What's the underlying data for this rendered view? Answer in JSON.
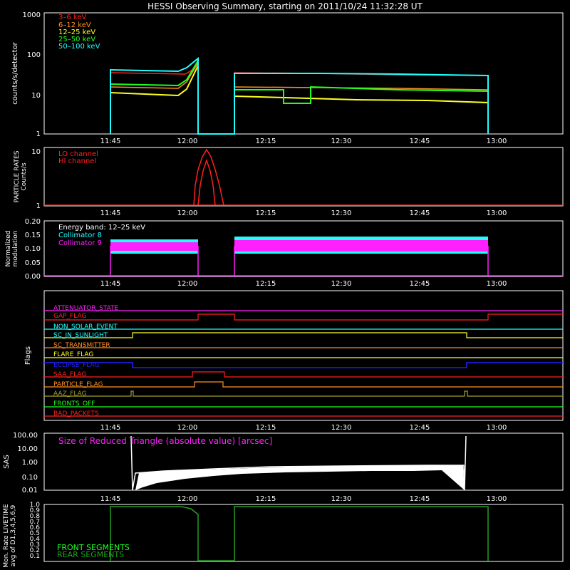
{
  "title": "HESSI Observing Summary, starting on 2011/10/24 11:32:28 UT",
  "x_tick_labels": [
    "11:45",
    "12:00",
    "12:15",
    "12:30",
    "12:45",
    "13:00"
  ],
  "colors": {
    "background": "#000000",
    "axes": "#ffffff",
    "red": "#ff2020",
    "orange": "#ff9020",
    "yellow": "#ffff20",
    "green": "#20ff20",
    "cyan": "#20ffff",
    "magenta": "#ff20ff",
    "blue": "#2020ff",
    "olive": "#a0a030",
    "darkgreen": "#20a020"
  },
  "panels": {
    "lightcurves": {
      "ylabel": "counts/s/detector",
      "y_ticks": [
        "1",
        "10",
        "100",
        "1000"
      ],
      "legend": [
        "3–6 keV",
        "6–12 keV",
        "12–25 keV",
        "25–50 keV",
        "50–100 keV"
      ]
    },
    "particle": {
      "ylabel_line1": "PARTICLE RATES",
      "ylabel_line2": "Counts/s",
      "y_ticks": [
        "1",
        "10"
      ],
      "legend": [
        "LO channel",
        "HI channel"
      ]
    },
    "modulation": {
      "ylabel_line1": "Normalized",
      "ylabel_line2": "modulation",
      "y_ticks": [
        "0.00",
        "0.05",
        "0.10",
        "0.15",
        "0.20"
      ],
      "legend": [
        "Energy band: 12–25 keV",
        "Collimator 8",
        "Collimator 9"
      ]
    },
    "flags": {
      "ylabel": "Flags",
      "names": [
        "ATTENUATOR_STATE",
        "GAP_FLAG",
        "NON_SOLAR_EVENT",
        "SC_IN_SUNLIGHT",
        "SC_TRANSMITTER",
        "FLARE_FLAG",
        "ECLIPSE_FLAG",
        "SAA_FLAG",
        "PARTICLE_FLAG",
        "AAZ_FLAG",
        "FRONTS_OFF",
        "BAD_PACKETS"
      ]
    },
    "sas": {
      "ylabel": "SAS",
      "y_ticks": [
        "0.01",
        "0.10",
        "1.00",
        "10.00",
        "100.00"
      ],
      "annotation": "Size of Reduced Triangle (absolute value) [arcsec]"
    },
    "livetime": {
      "ylabel_line1": "Mon. Rate LIVETIME",
      "ylabel_line2": "avg of D1,3,4,5,6,9",
      "y_ticks": [
        "0.1",
        "0.2",
        "0.3",
        "0.4",
        "0.5",
        "0.6",
        "0.7",
        "0.8",
        "0.9",
        "1.0"
      ],
      "legend": [
        "FRONT SEGMENTS",
        "REAR SEGMENTS"
      ]
    }
  },
  "chart_data": [
    {
      "type": "line",
      "title": "HESSI Observing Summary, starting on 2011/10/24 11:32:28 UT",
      "ylabel": "counts/s/detector",
      "yscale": "log",
      "ylim": [
        1,
        1000
      ],
      "x_units": "UT",
      "xlim": [
        "11:32:28",
        "13:15"
      ],
      "series": [
        {
          "name": "3–6 keV",
          "color": "#ff2020",
          "points": [
            [
              "11:45",
              30
            ],
            [
              "11:55",
              30
            ],
            [
              "12:00",
              40
            ],
            [
              "12:02",
              60
            ],
            [
              "12:10",
              30
            ],
            [
              "12:30",
              30
            ],
            [
              "12:58",
              28
            ]
          ]
        },
        {
          "name": "6–12 keV",
          "color": "#ff9020",
          "points": [
            [
              "11:45",
              20
            ],
            [
              "11:55",
              18
            ],
            [
              "12:00",
              30
            ],
            [
              "12:02",
              50
            ],
            [
              "12:10",
              15
            ],
            [
              "12:30",
              15
            ],
            [
              "12:58",
              13
            ]
          ]
        },
        {
          "name": "12–25 keV",
          "color": "#ffff20",
          "points": [
            [
              "11:45",
              12
            ],
            [
              "11:55",
              11
            ],
            [
              "12:00",
              20
            ],
            [
              "12:02",
              40
            ],
            [
              "12:10",
              10
            ],
            [
              "12:30",
              9
            ],
            [
              "12:58",
              7
            ]
          ]
        },
        {
          "name": "25–50 keV",
          "color": "#20ff20",
          "points": [
            [
              "11:45",
              22
            ],
            [
              "11:55",
              20
            ],
            [
              "12:00",
              35
            ],
            [
              "12:02",
              60
            ],
            [
              "12:10",
              13
            ],
            [
              "12:18",
              6
            ],
            [
              "12:23",
              14
            ],
            [
              "12:58",
              12
            ]
          ]
        },
        {
          "name": "50–100 keV",
          "color": "#20ffff",
          "points": [
            [
              "11:45",
              38
            ],
            [
              "11:55",
              35
            ],
            [
              "12:00",
              45
            ],
            [
              "12:02",
              70
            ],
            [
              "12:10",
              30
            ],
            [
              "12:30",
              30
            ],
            [
              "12:58",
              28
            ]
          ]
        }
      ]
    },
    {
      "type": "line",
      "ylabel": "PARTICLE RATES Counts/s",
      "yscale": "log",
      "ylim": [
        1,
        10
      ],
      "series": [
        {
          "name": "LO channel",
          "color": "#ff2020",
          "points": [
            [
              "12:00",
              1
            ],
            [
              "12:02",
              4
            ],
            [
              "12:04",
              10
            ],
            [
              "12:06",
              4
            ],
            [
              "12:08",
              1
            ]
          ]
        },
        {
          "name": "HI channel",
          "color": "#ff2020",
          "points": [
            [
              "12:01",
              1
            ],
            [
              "12:03",
              4
            ],
            [
              "12:04",
              8
            ],
            [
              "12:05",
              4
            ],
            [
              "12:07",
              1
            ]
          ]
        }
      ]
    },
    {
      "type": "line",
      "ylabel": "Normalized modulation",
      "ylim": [
        0,
        0.2
      ],
      "series": [
        {
          "name": "Collimator 8",
          "color": "#20ffff",
          "points": [
            [
              "11:45",
              0.11
            ],
            [
              "12:02",
              0.11
            ],
            [
              "12:10",
              0.11
            ],
            [
              "12:58",
              0.11
            ]
          ]
        },
        {
          "name": "Collimator 9",
          "color": "#ff20ff",
          "points": [
            [
              "11:45",
              0.11
            ],
            [
              "12:02",
              0.11
            ],
            [
              "12:10",
              0.11
            ],
            [
              "12:58",
              0.11
            ]
          ]
        }
      ]
    },
    {
      "type": "line",
      "ylabel": "SAS",
      "yscale": "log",
      "ylim": [
        0.01,
        100
      ],
      "series": [
        {
          "name": "Size of Reduced Triangle (absolute value) [arcsec]",
          "color": "#ffffff",
          "points": [
            [
              "11:48",
              60
            ],
            [
              "11:49",
              0.02
            ],
            [
              "12:00",
              0.3
            ],
            [
              "12:15",
              0.4
            ],
            [
              "12:30",
              0.45
            ],
            [
              "12:50",
              0.45
            ],
            [
              "12:53",
              0.02
            ],
            [
              "12:53",
              100
            ]
          ]
        }
      ]
    },
    {
      "type": "line",
      "ylabel": "Mon. Rate LIVETIME avg of D1,3,4,5,6,9",
      "ylim": [
        0,
        1
      ],
      "series": [
        {
          "name": "FRONT SEGMENTS",
          "color": "#20a020",
          "points": [
            [
              "11:45",
              0.97
            ],
            [
              "11:58",
              0.97
            ],
            [
              "12:02",
              0.9
            ],
            [
              "12:02",
              0.01
            ],
            [
              "12:10",
              0.01
            ],
            [
              "12:10",
              0.97
            ],
            [
              "12:58",
              0.97
            ],
            [
              "12:58",
              0.01
            ]
          ]
        }
      ]
    }
  ]
}
